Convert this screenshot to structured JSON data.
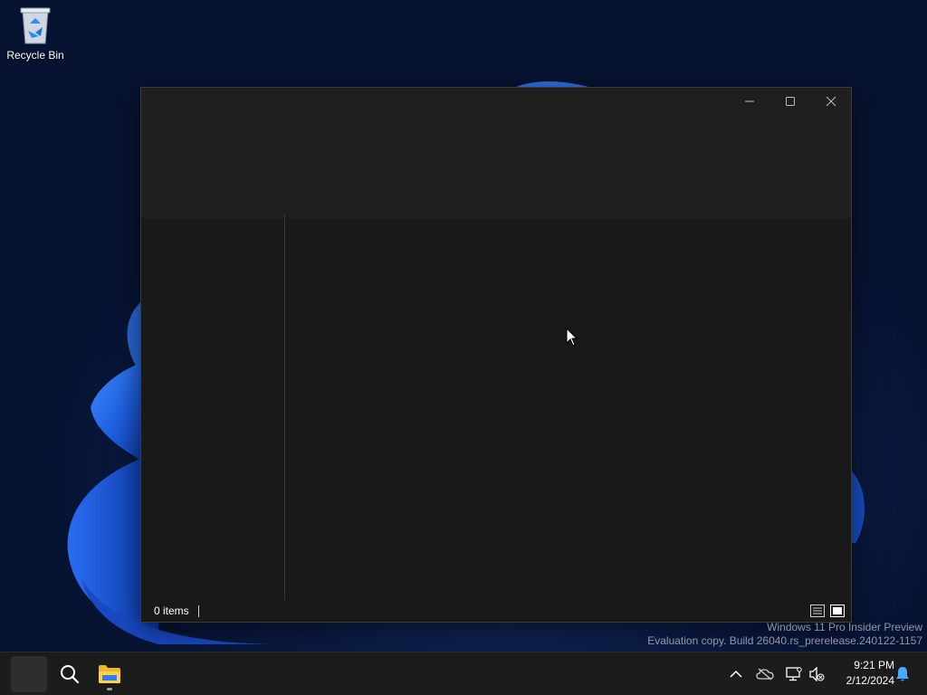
{
  "desktop": {
    "icons": [
      {
        "label": "Recycle Bin",
        "icon": "recycle-bin-icon"
      }
    ],
    "watermark": {
      "line1": "Windows 11 Pro Insider Preview",
      "line2": "Evaluation copy. Build 26040.rs_prerelease.240122-1157"
    }
  },
  "window": {
    "caption_buttons": [
      "minimize-icon",
      "maximize-icon",
      "close-icon"
    ],
    "status_bar": {
      "item_count": "0 items",
      "view_buttons": [
        "details-view-icon",
        "large-icons-view-icon"
      ]
    }
  },
  "taskbar": {
    "pinned": [
      "start-icon",
      "search-icon",
      "file-explorer-icon"
    ],
    "tray": [
      "chevron-up-icon",
      "onedrive-offline-icon",
      "network-icon",
      "volume-muted-icon",
      "notification-bell-icon"
    ],
    "clock": {
      "time": "9:21 PM",
      "date": "2/12/2024"
    }
  },
  "colors": {
    "window_bg": "#191919",
    "title_area_bg": "#1f1f1f",
    "taskbar_bg": "#1c1c1c",
    "accent": "#2f7bf5"
  }
}
